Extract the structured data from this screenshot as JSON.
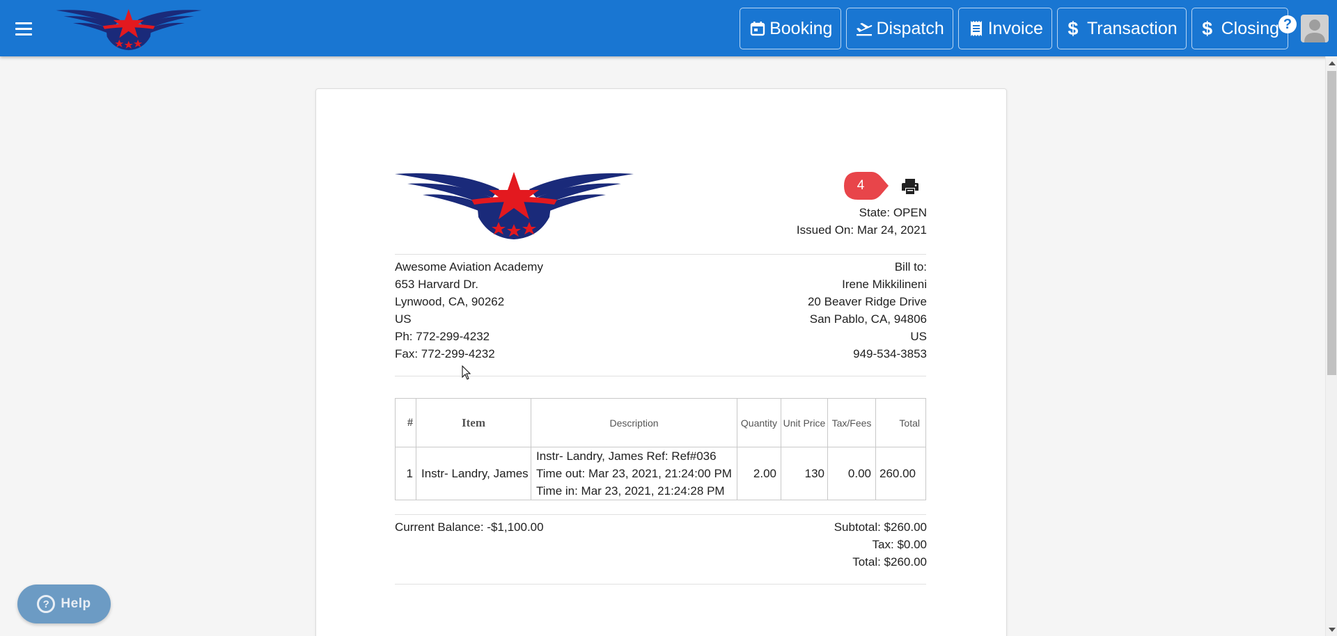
{
  "header": {
    "nav": [
      {
        "label": "Booking",
        "icon": "calendar-icon"
      },
      {
        "label": "Dispatch",
        "icon": "plane-takeoff-icon"
      },
      {
        "label": "Invoice",
        "icon": "receipt-icon"
      },
      {
        "label": "Transaction",
        "icon": "dollar-icon"
      },
      {
        "label": "Closing",
        "icon": "dollar-icon"
      }
    ],
    "help_glyph": "?"
  },
  "invoice": {
    "state": "State: OPEN",
    "issued": "Issued On: Mar 24, 2021",
    "step_badge": "4",
    "from": [
      "Awesome Aviation Academy",
      "653 Harvard Dr.",
      "Lynwood, CA, 90262",
      "US",
      "Ph: 772-299-4232",
      "Fax: 772-299-4232"
    ],
    "bill_to": [
      "Bill to:",
      "Irene Mikkilineni",
      "20 Beaver Ridge Drive",
      "San Pablo, CA, 94806",
      "US",
      "949-534-3853"
    ],
    "table": {
      "headers": [
        "#",
        "Item",
        "Description",
        "Quantity",
        "Unit Price",
        "Tax/Fees",
        "Total"
      ],
      "rows": [
        {
          "num": "1",
          "item": "Instr- Landry, James",
          "desc": [
            "Instr- Landry, James Ref: Ref#036",
            "Time out: Mar 23, 2021, 21:24:00 PM",
            "Time in: Mar 23, 2021, 21:24:28 PM"
          ],
          "qty": "2.00",
          "unit": "130",
          "tax": "0.00",
          "total": "260.00"
        }
      ]
    },
    "balance": "Current Balance: -$1,100.00",
    "subtotal": "Subtotal: $260.00",
    "tax": "Tax: $0.00",
    "total": "Total: $260.00"
  },
  "help_fab": {
    "label": "Help"
  },
  "colors": {
    "appbar": "#1976d2",
    "logo_navy": "#1a2a7a",
    "logo_red": "#e3191f",
    "badge_red": "#e8454a"
  }
}
